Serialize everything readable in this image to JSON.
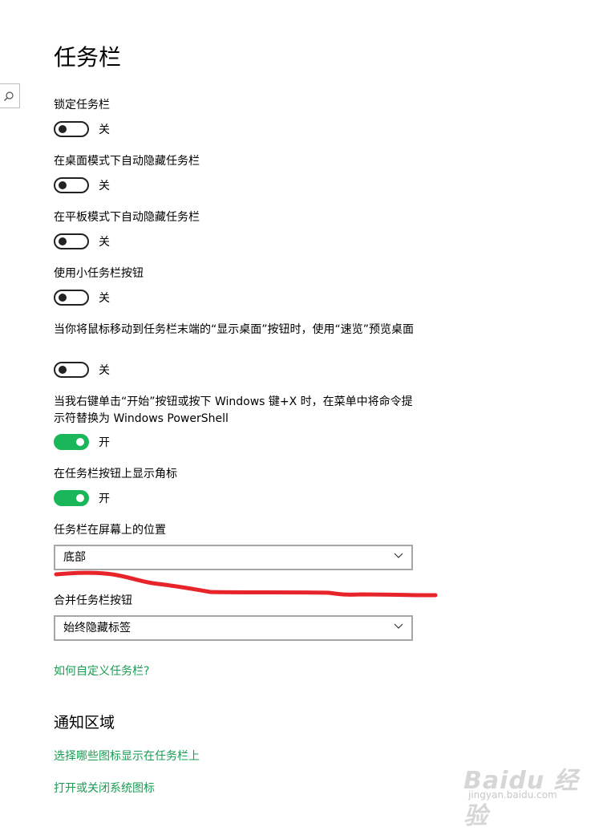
{
  "page": {
    "title": "任务栏"
  },
  "settings": [
    {
      "label": "锁定任务栏",
      "state": "关",
      "on": false
    },
    {
      "label": "在桌面模式下自动隐藏任务栏",
      "state": "关",
      "on": false
    },
    {
      "label": "在平板模式下自动隐藏任务栏",
      "state": "关",
      "on": false
    },
    {
      "label": "使用小任务栏按钮",
      "state": "关",
      "on": false
    },
    {
      "label": "当你将鼠标移动到任务栏末端的“显示桌面”按钮时，使用“速览”预览桌面",
      "state": "关",
      "on": false
    },
    {
      "label": "当我右键单击“开始”按钮或按下 Windows 键+X 时，在菜单中将命令提示符替换为 Windows PowerShell",
      "state": "开",
      "on": true
    },
    {
      "label": "在任务栏按钮上显示角标",
      "state": "开",
      "on": true
    }
  ],
  "position_select": {
    "label": "任务栏在屏幕上的位置",
    "value": "底部"
  },
  "combine_select": {
    "label": "合并任务栏按钮",
    "value": "始终隐藏标签"
  },
  "links": {
    "customize": "如何自定义任务栏?",
    "notification_title": "通知区域",
    "select_icons": "选择哪些图标显示在任务栏上",
    "system_icons": "打开或关闭系统图标"
  },
  "icons": {
    "search": "search-icon",
    "dropdown": "chevron-down-icon"
  },
  "colors": {
    "toggle_on": "#19b75a",
    "link": "#1a9c52",
    "annotation": "#e8242b"
  },
  "watermark": {
    "brand": "Baidu 经验",
    "site": "jingyan.baidu.com"
  }
}
